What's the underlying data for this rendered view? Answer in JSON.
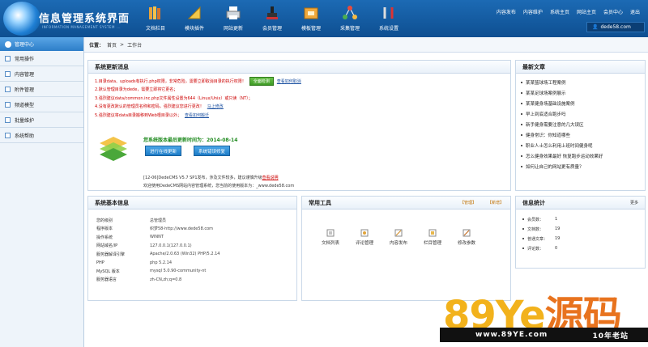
{
  "header": {
    "title": "信息管理系统界面",
    "subtitle": "INFORMATION MANAGEMENT SYSTEM ...",
    "nav": [
      {
        "label": "文档栏目",
        "icon": "books-icon"
      },
      {
        "label": "模块插件",
        "icon": "ruler-icon"
      },
      {
        "label": "网站更新",
        "icon": "printer-icon"
      },
      {
        "label": "会员管理",
        "icon": "stamp-icon"
      },
      {
        "label": "模板管理",
        "icon": "folder-icon"
      },
      {
        "label": "采集管理",
        "icon": "network-icon"
      },
      {
        "label": "系统设置",
        "icon": "tools-icon"
      }
    ],
    "toplinks": [
      "内容发布",
      "内容维护",
      "系统主页",
      "网站主页",
      "会员中心",
      "退出"
    ],
    "user": "dede58.com"
  },
  "sidebar": {
    "head": "管理中心",
    "items": [
      "常用操作",
      "内容管理",
      "附件管理",
      "频道模型",
      "批量维护",
      "系统帮助"
    ]
  },
  "breadcrumb": {
    "label": "位置：",
    "home": "首页",
    "sep": ">",
    "current": "工作台"
  },
  "update_panel": {
    "title": "系统更新消息",
    "messages": [
      {
        "text": "1.目录data、uploads有执行.php权限，非常危险，需要立即取消目录的执行权限！",
        "link": "查看如何取消",
        "button": "全面检测"
      },
      {
        "text": "2.默认管理目录为dede，需要立即将它更名；",
        "link": ""
      },
      {
        "text": "3.强烈建议data/common.inc.php文件属性设置为644（Linux/Unix）或只读（NT）；",
        "link": ""
      },
      {
        "text": "4.没有更改默认的管理员名称和密码，强烈建议您进行更改！",
        "link": "马上修改"
      },
      {
        "text": "5.强烈建议将data目录搬移到Web根目录以外；",
        "link": "查看如何搬迁"
      }
    ],
    "update_time": "您系统版本最后更新时间为：2014-08-14",
    "btn_online": "进行在线更新",
    "btn_error": "系统错误修复",
    "news_line1": "[12-06]DedeCMS V5.7 SP1发布，涉及文件较多，建议谨慎升级",
    "news_line1_link": "查看说明",
    "news_line2": "欢迎使用DedeCMS网站内容管理系统，您当前的使用版本为：_www.dede58.com"
  },
  "latest_articles": {
    "title": "最新文章",
    "items": [
      "某某篮球场工程案例",
      "某某足球场案例展示",
      "某某健身场基础设施案例",
      "早上到底适合跑步吗",
      "新手健身需要注意的几大误区",
      "健身常识：你知道哪些",
      "职业人士怎么利用上班时间健身呢",
      "怎么健身效果最好 恢复跑步运动效果好",
      "如何让自己的网站更有质量？"
    ]
  },
  "sysinfo": {
    "title": "系统基本信息",
    "rows": [
      {
        "k": "您的级别",
        "v": "总管理员"
      },
      {
        "k": "程序版本",
        "v": "织梦58-http://www.dede58.com"
      },
      {
        "k": "操作系统",
        "v": "WINNT"
      },
      {
        "k": "网站域名/IP",
        "v": "127.0.0.1(127.0.0.1)"
      },
      {
        "k": "服务器解译引擎",
        "v": "Apache/2.0.63 (Win32) PHP/5.2.14"
      },
      {
        "k": "PHP",
        "v": "php 5.2.14"
      },
      {
        "k": "MySQL 版本",
        "v": "mysql 5.0.90-community-nt"
      },
      {
        "k": "服务器语言",
        "v": "zh-CN,zh;q=0.8"
      }
    ]
  },
  "tools": {
    "title": "常用工具",
    "manage": "【管理】",
    "add": "【新增】",
    "items": [
      {
        "label": "文档列表",
        "icon": "doc-list-icon"
      },
      {
        "label": "评论管理",
        "icon": "comment-icon"
      },
      {
        "label": "内容发布",
        "icon": "publish-icon"
      },
      {
        "label": "栏目管理",
        "icon": "column-icon"
      },
      {
        "label": "修改参数",
        "icon": "edit-params-icon"
      }
    ]
  },
  "stats": {
    "title": "信息统计",
    "more": "更多",
    "rows": [
      {
        "k": "会员数：",
        "v": "1"
      },
      {
        "k": "文档数：",
        "v": "19"
      },
      {
        "k": "普通文章：",
        "v": "19"
      },
      {
        "k": "评论数：",
        "v": "0"
      }
    ]
  },
  "watermark": {
    "main_a": "89",
    "main_b": "Ye",
    "main_c": "源码",
    "url": "www.89YE.com",
    "tag": "10年老站"
  }
}
